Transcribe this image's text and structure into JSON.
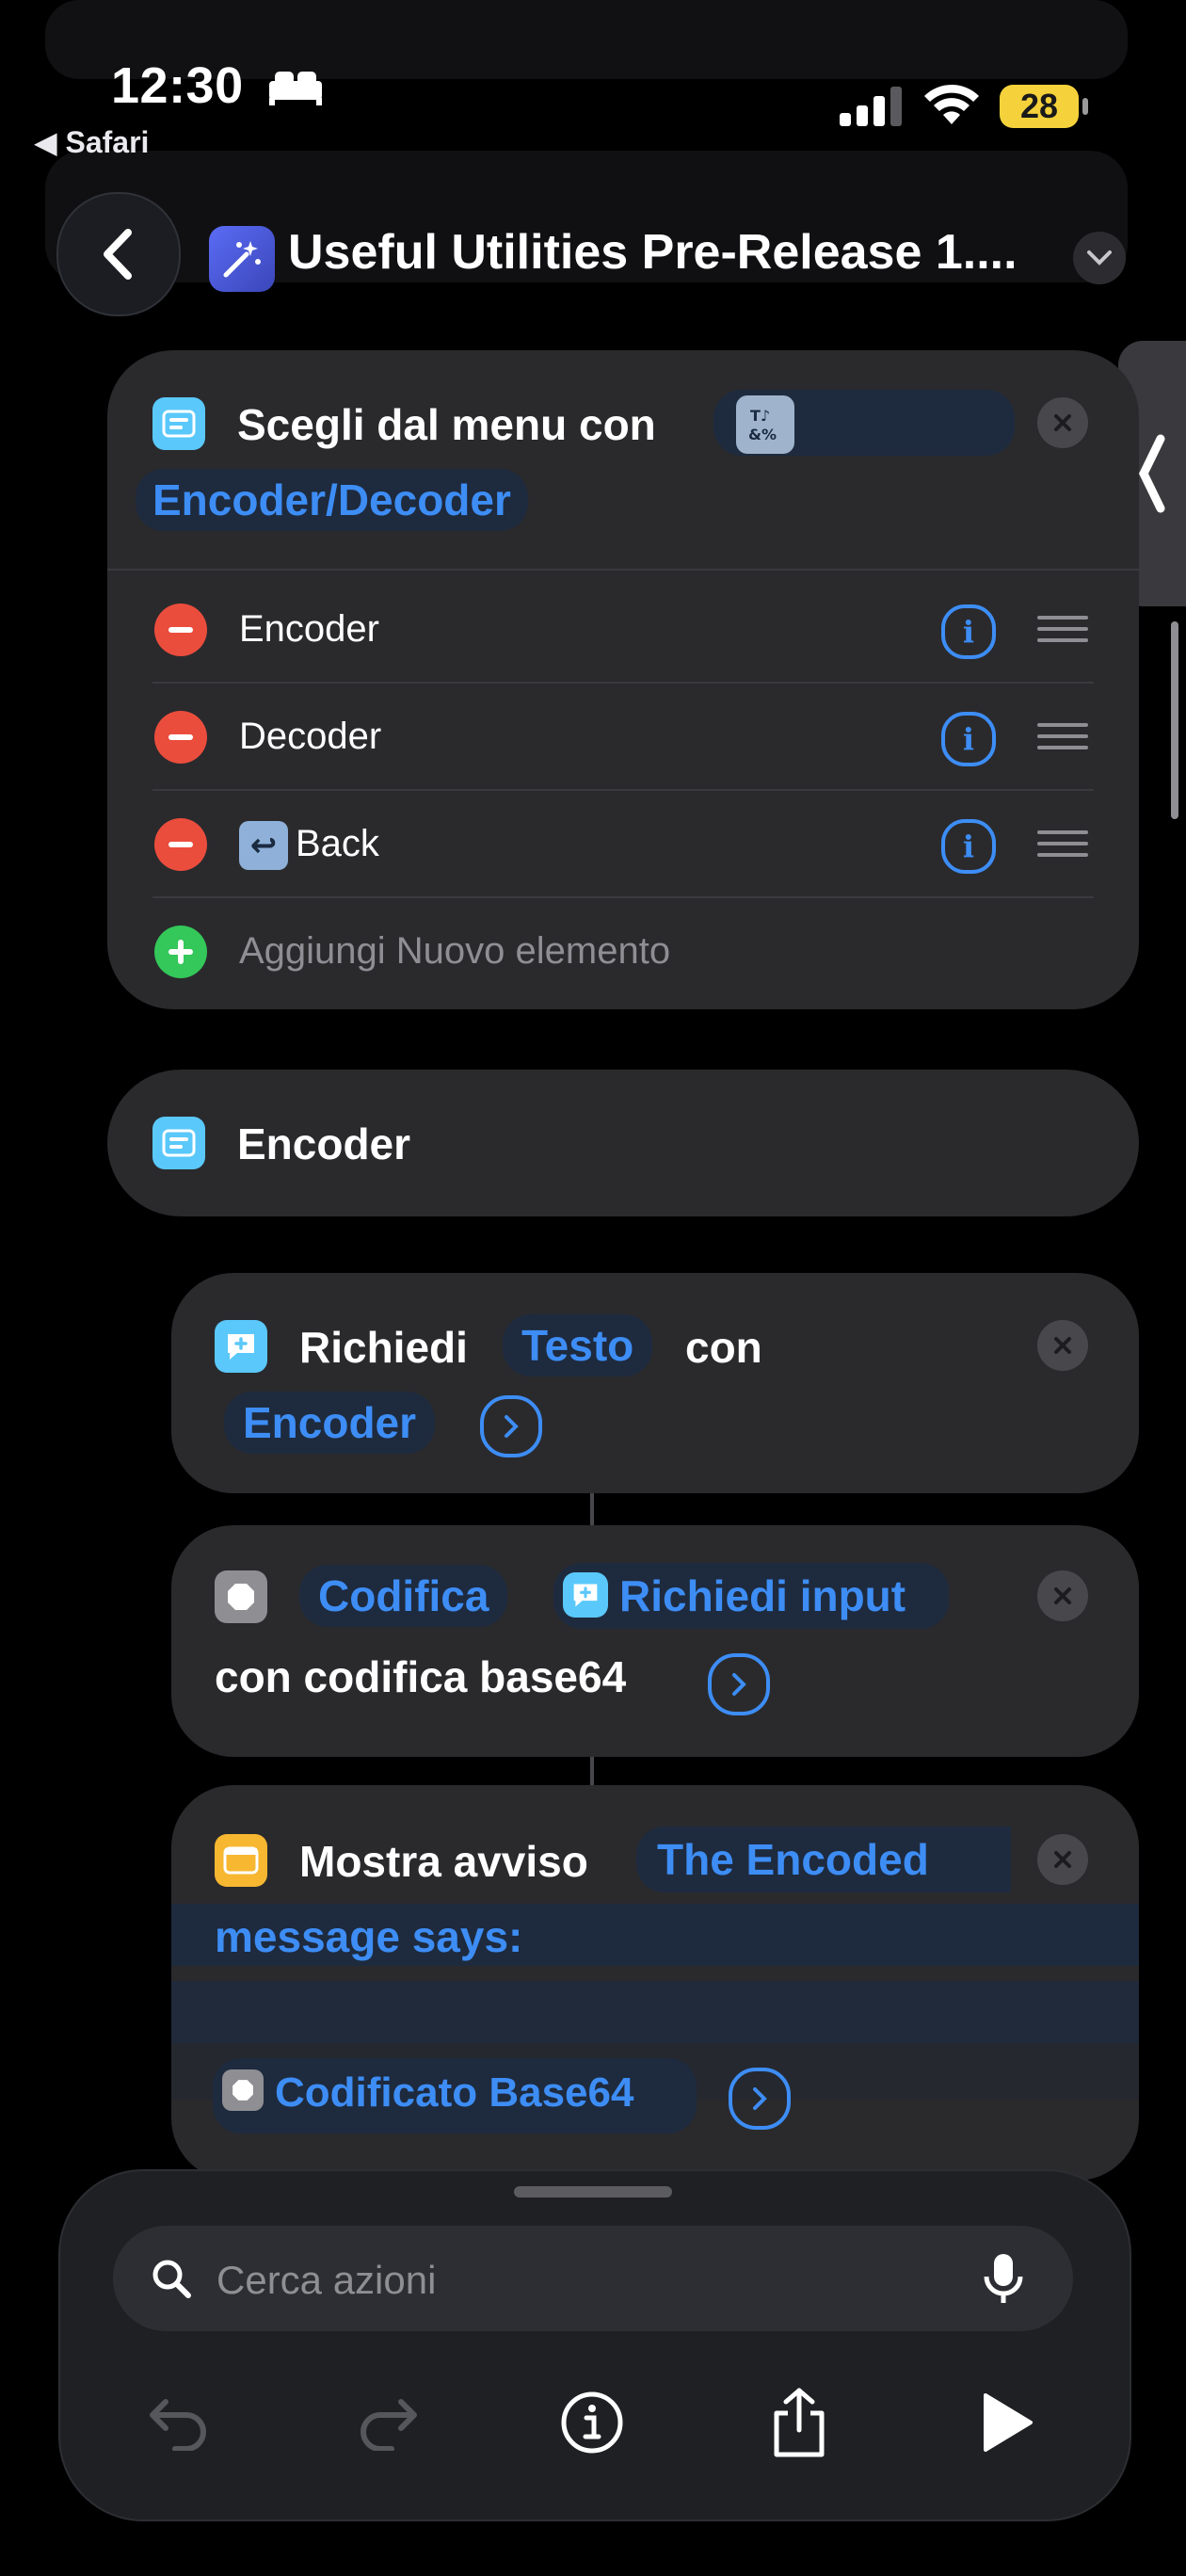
{
  "status": {
    "time": "12:30",
    "back_app": "◀ Safari",
    "battery": "28"
  },
  "header": {
    "title": "Useful Utilities Pre-Release 1...."
  },
  "menu_action": {
    "prefix": "Scegli dal menu con",
    "prompt": "Encoder/Decoder",
    "items": [
      {
        "label": "Encoder"
      },
      {
        "label": "Decoder"
      },
      {
        "label": "Back",
        "emoji": "↩"
      }
    ],
    "add_label": "Aggiungi Nuovo elemento"
  },
  "encoder_section": {
    "label": "Encoder"
  },
  "ask_action": {
    "verb": "Richiedi",
    "type": "Testo",
    "with": "con",
    "prompt": "Encoder"
  },
  "encode_action": {
    "verb": "Codifica",
    "input": "Richiedi input",
    "suffix": "con codifica base64"
  },
  "alert_action": {
    "verb": "Mostra avviso",
    "text_line1": "The Encoded",
    "text_line2": "message says:",
    "variable": "Codificato Base64"
  },
  "search": {
    "placeholder": "Cerca azioni"
  },
  "colors": {
    "accent": "#3d8df5",
    "card": "#2a2a2d",
    "danger": "#eb4d3d",
    "add": "#34c759",
    "battery": "#f5d23b"
  }
}
